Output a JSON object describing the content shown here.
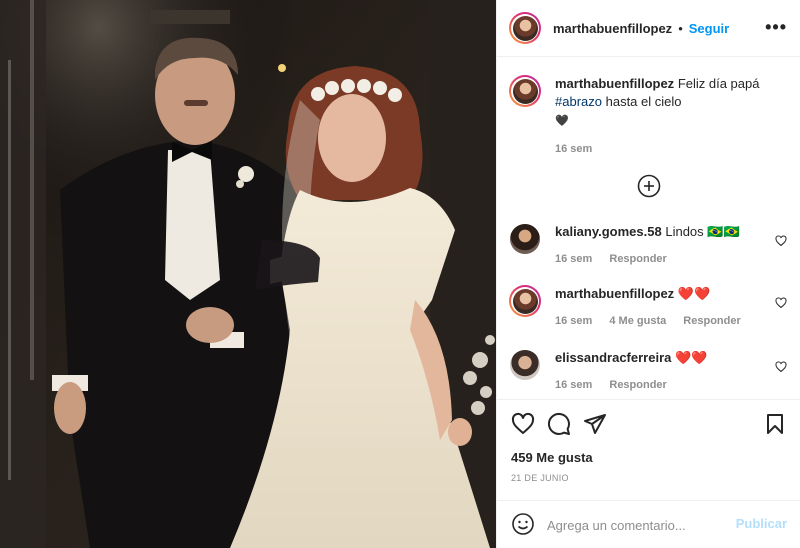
{
  "post": {
    "username": "marthabuenfillopez",
    "follow_label": "Seguir",
    "separator": "•",
    "more_label": "•••"
  },
  "caption": {
    "username": "marthabuenfillopez",
    "text_before": "Feliz día papá",
    "hashtag": "#abrazo",
    "text_after": "hasta el cielo",
    "heart": "🖤",
    "time": "16 sem"
  },
  "comments": [
    {
      "username": "kaliany.gomes.58",
      "text": "Lindos 🇧🇷🇧🇷",
      "time": "16 sem",
      "likes": "",
      "reply": "Responder"
    },
    {
      "username": "marthabuenfillopez",
      "text": "❤️❤️",
      "time": "16 sem",
      "likes": "4 Me gusta",
      "reply": "Responder"
    },
    {
      "username": "elissandracferreira",
      "text": "❤️❤️",
      "time": "16 sem",
      "likes": "",
      "reply": "Responder"
    }
  ],
  "stats": {
    "likes": "459 Me gusta",
    "date": "21 DE JUNIO"
  },
  "composer": {
    "placeholder": "Agrega un comentario...",
    "publish_label": "Publicar"
  },
  "colors": {
    "accent": "#0095f6",
    "link": "#00376b",
    "muted": "#8e8e8e",
    "publish_disabled": "#b2dffc"
  }
}
